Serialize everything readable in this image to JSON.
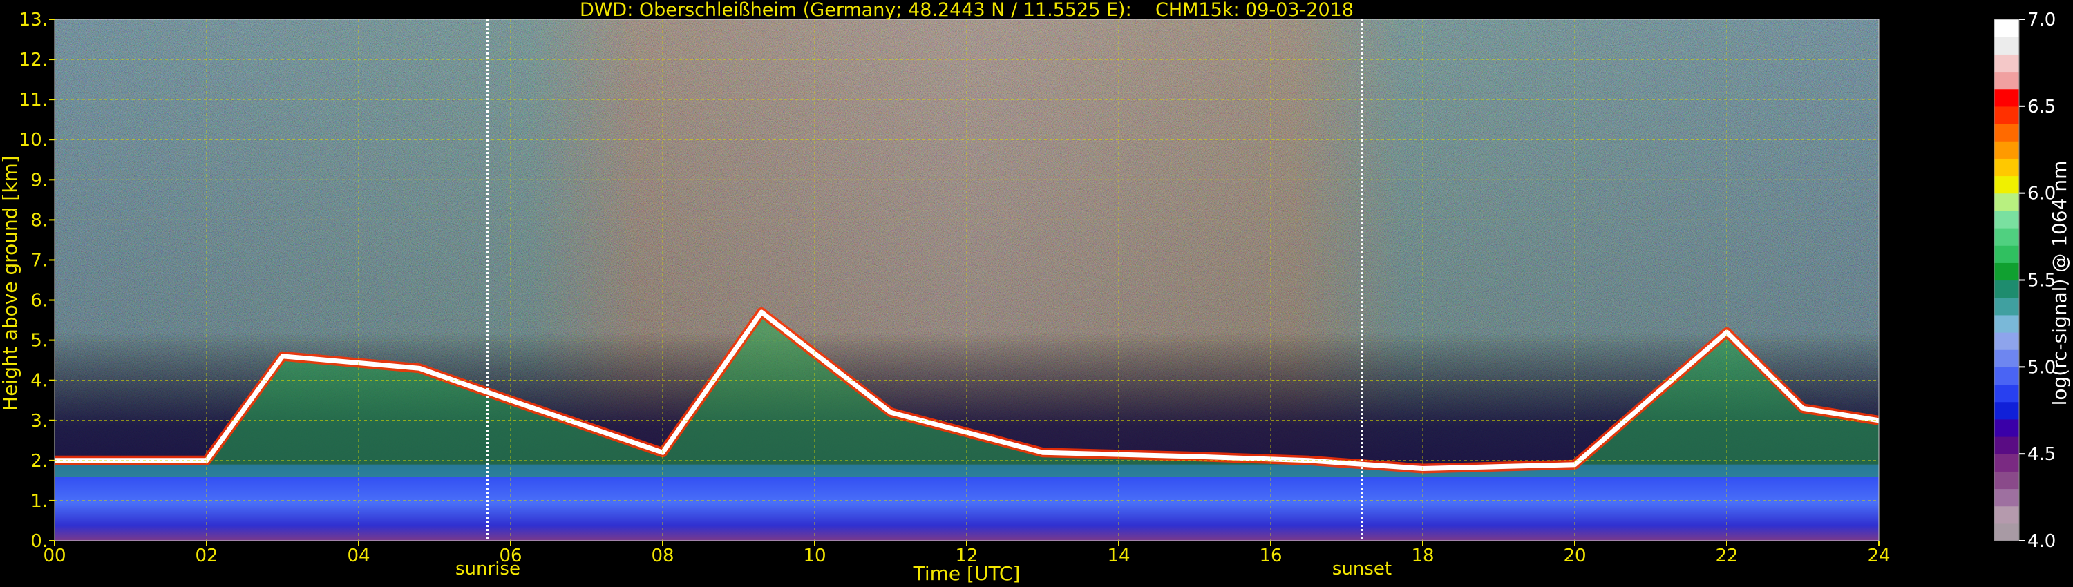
{
  "chart_data": {
    "type": "heatmap",
    "title": "DWD: Oberschleißheim (Germany; 48.2443 N / 11.5525 E):    CHM15k: 09-03-2018",
    "xlabel": "Time [UTC]",
    "ylabel": "Height above ground [km]",
    "xlim": [
      0,
      24
    ],
    "ylim": [
      0,
      13
    ],
    "x_ticks": [
      {
        "value": 0,
        "label": "00"
      },
      {
        "value": 2,
        "label": "02"
      },
      {
        "value": 4,
        "label": "04"
      },
      {
        "value": 6,
        "label": "06"
      },
      {
        "value": 8,
        "label": "08"
      },
      {
        "value": 10,
        "label": "10"
      },
      {
        "value": 12,
        "label": "12"
      },
      {
        "value": 14,
        "label": "14"
      },
      {
        "value": 16,
        "label": "16"
      },
      {
        "value": 18,
        "label": "18"
      },
      {
        "value": 20,
        "label": "20"
      },
      {
        "value": 22,
        "label": "22"
      },
      {
        "value": 24,
        "label": "24"
      }
    ],
    "y_ticks": [
      {
        "value": 0,
        "label": "0."
      },
      {
        "value": 1,
        "label": "1."
      },
      {
        "value": 2,
        "label": "2."
      },
      {
        "value": 3,
        "label": "3."
      },
      {
        "value": 4,
        "label": "4."
      },
      {
        "value": 5,
        "label": "5."
      },
      {
        "value": 6,
        "label": "6."
      },
      {
        "value": 7,
        "label": "7."
      },
      {
        "value": 8,
        "label": "8."
      },
      {
        "value": 9,
        "label": "9."
      },
      {
        "value": 10,
        "label": "10."
      },
      {
        "value": 11,
        "label": "11."
      },
      {
        "value": 12,
        "label": "12."
      },
      {
        "value": 13,
        "label": "13."
      }
    ],
    "grid": true,
    "grid_color": "#d8d800",
    "sun_events": [
      {
        "label": "sunrise",
        "time": 5.7
      },
      {
        "label": "sunset",
        "time": 17.2
      }
    ],
    "colorbar": {
      "label": "log(rc-signal) @ 1064 nm",
      "range": [
        4.0,
        7.0
      ],
      "ticks": [
        {
          "value": 4.0,
          "label": "4.0"
        },
        {
          "value": 4.5,
          "label": "4.5"
        },
        {
          "value": 5.0,
          "label": "5.0"
        },
        {
          "value": 5.5,
          "label": "5.5"
        },
        {
          "value": 6.0,
          "label": "6.0"
        },
        {
          "value": 6.5,
          "label": "6.5"
        },
        {
          "value": 7.0,
          "label": "7.0"
        }
      ],
      "colors": [
        "#a89aa4",
        "#b59aad",
        "#9e70a0",
        "#8a4a8a",
        "#7a2a82",
        "#5a0c84",
        "#3a00a8",
        "#1020d8",
        "#2840f0",
        "#4a64f4",
        "#6e86f0",
        "#8ea4ec",
        "#7ab8d8",
        "#40a0a0",
        "#1e8c6e",
        "#10a030",
        "#30c060",
        "#50d080",
        "#7ae0a0",
        "#b8f080",
        "#f0f000",
        "#ffc800",
        "#ff9a00",
        "#ff6a00",
        "#ff3000",
        "#ff0000",
        "#f0a0a0",
        "#f4c8c8",
        "#ececec",
        "#ffffff"
      ]
    },
    "layers": {
      "boundary_layer": {
        "top_km": 1.9,
        "description_color": "#2840f0"
      },
      "cloud_tops_km": [
        {
          "t": 0.0,
          "h": 2.0
        },
        {
          "t": 2.0,
          "h": 2.0
        },
        {
          "t": 3.0,
          "h": 4.6
        },
        {
          "t": 4.8,
          "h": 4.3
        },
        {
          "t": 6.0,
          "h": 3.5
        },
        {
          "t": 8.0,
          "h": 2.2
        },
        {
          "t": 9.3,
          "h": 5.7
        },
        {
          "t": 11.0,
          "h": 3.2
        },
        {
          "t": 13.0,
          "h": 2.2
        },
        {
          "t": 15.0,
          "h": 2.1
        },
        {
          "t": 16.5,
          "h": 2.0
        },
        {
          "t": 18.0,
          "h": 1.8
        },
        {
          "t": 20.0,
          "h": 1.9
        },
        {
          "t": 22.0,
          "h": 5.2
        },
        {
          "t": 23.0,
          "h": 3.3
        },
        {
          "t": 24.0,
          "h": 3.0
        }
      ]
    },
    "colors": {
      "axis_text": "#f2e600",
      "background": "#000000"
    }
  }
}
